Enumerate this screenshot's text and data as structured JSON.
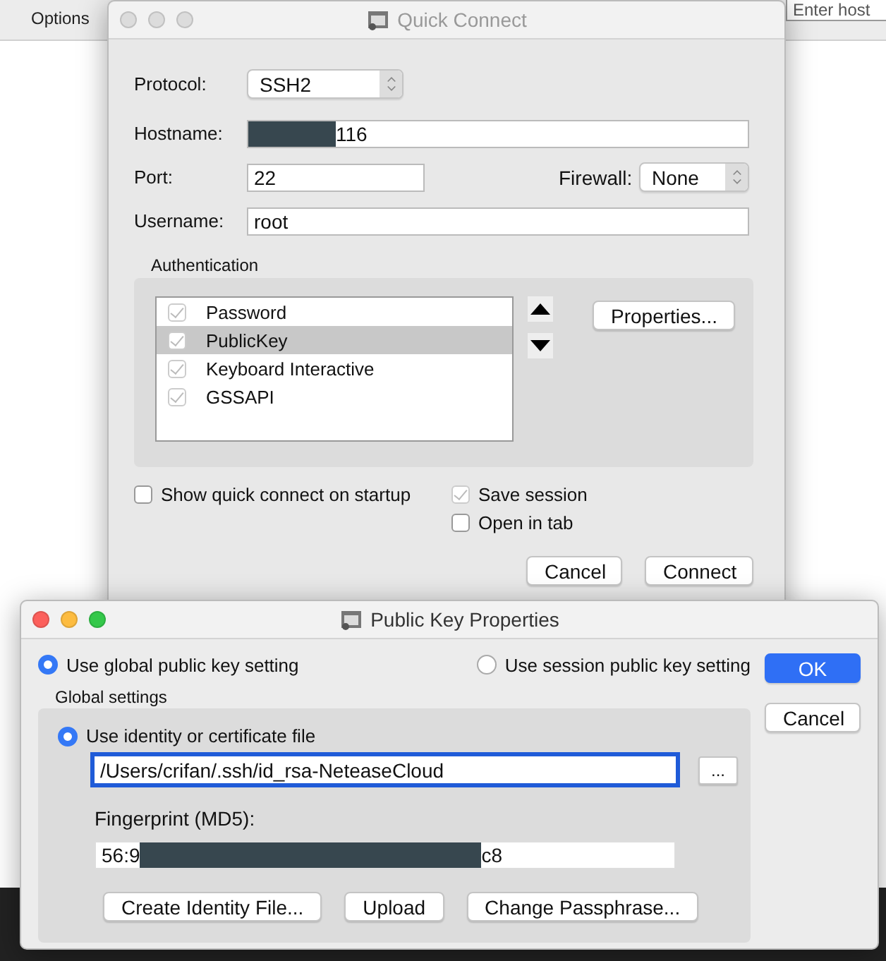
{
  "background": {
    "toolbar_label": "Options",
    "host_field_text": "Enter host"
  },
  "quick_connect": {
    "title": "Quick Connect",
    "protocol": {
      "label": "Protocol:",
      "value": "SSH2"
    },
    "hostname": {
      "label": "Hostname:",
      "value": "116",
      "redacted": true
    },
    "port": {
      "label": "Port:",
      "value": "22"
    },
    "firewall": {
      "label": "Firewall:",
      "value": "None"
    },
    "username": {
      "label": "Username:",
      "value": "root"
    },
    "authentication": {
      "title": "Authentication",
      "methods": [
        {
          "label": "Password",
          "checked": true,
          "selected": false
        },
        {
          "label": "PublicKey",
          "checked": true,
          "selected": true
        },
        {
          "label": "Keyboard Interactive",
          "checked": true,
          "selected": false
        },
        {
          "label": "GSSAPI",
          "checked": true,
          "selected": false
        }
      ],
      "properties_button": "Properties..."
    },
    "options": [
      {
        "label": "Show quick connect on startup",
        "checked": false,
        "disabled": false
      },
      {
        "label": "Save session",
        "checked": true,
        "disabled": true
      },
      {
        "label": "Open in tab",
        "checked": false,
        "disabled": false
      }
    ],
    "buttons": [
      "Cancel",
      "Connect"
    ]
  },
  "public_key_properties": {
    "title": "Public Key Properties",
    "scope_options": [
      {
        "label": "Use global public key setting",
        "selected": true
      },
      {
        "label": "Use session public key setting",
        "selected": false
      }
    ],
    "ok_button": "OK",
    "cancel_button": "Cancel",
    "global_settings": {
      "title": "Global settings",
      "identity_option": {
        "label": "Use identity or certificate file",
        "selected": true
      },
      "file_path": "/Users/crifan/.ssh/id_rsa-NeteaseCloud",
      "browse_button": "...",
      "fingerprint_label": "Fingerprint (MD5):",
      "fingerprint_start": "56:9",
      "fingerprint_end": "c8",
      "fingerprint_redacted": true,
      "buttons": [
        "Create Identity File...",
        "Upload",
        "Change Passphrase..."
      ]
    }
  }
}
